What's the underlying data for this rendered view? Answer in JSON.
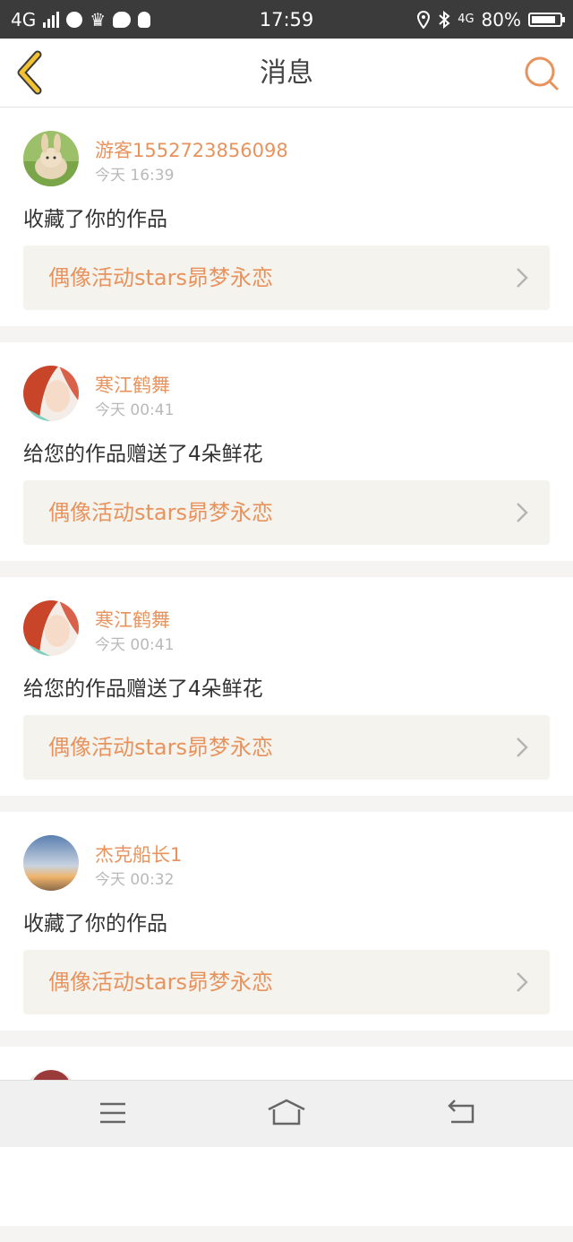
{
  "status_bar": {
    "network": "4G",
    "time": "17:59",
    "battery": "80%",
    "icons": [
      "signal-icon",
      "app-icon",
      "crown-icon",
      "wechat-icon",
      "qq-icon",
      "location-icon",
      "bluetooth-icon",
      "network-4g-icon",
      "battery-icon"
    ]
  },
  "header": {
    "title": "消息",
    "back_icon": "chevron-left-icon",
    "search_icon": "search-icon"
  },
  "messages": [
    {
      "user": "游客1552723856098",
      "time": "今天 16:39",
      "action": "收藏了你的作品",
      "work": "偶像活动stars昴梦永恋",
      "avatar": "rabbit"
    },
    {
      "user": "寒江鹤舞",
      "time": "今天 00:41",
      "action": "给您的作品赠送了4朵鲜花",
      "work": "偶像活动stars昴梦永恋",
      "avatar": "redhair"
    },
    {
      "user": "寒江鹤舞",
      "time": "今天 00:41",
      "action": "给您的作品赠送了4朵鲜花",
      "work": "偶像活动stars昴梦永恋",
      "avatar": "redhair"
    },
    {
      "user": "杰克船长1",
      "time": "今天 00:32",
      "action": "收藏了你的作品",
      "work": "偶像活动stars昴梦永恋",
      "avatar": "sky"
    }
  ],
  "colors": {
    "accent": "#e8935d",
    "back_arrow": "#f2c230",
    "statusbar": "#3b3b3b",
    "card_link_bg": "#f4f3ee"
  },
  "nav_bar": {
    "icons": [
      "menu-icon",
      "home-icon",
      "back-icon"
    ]
  }
}
